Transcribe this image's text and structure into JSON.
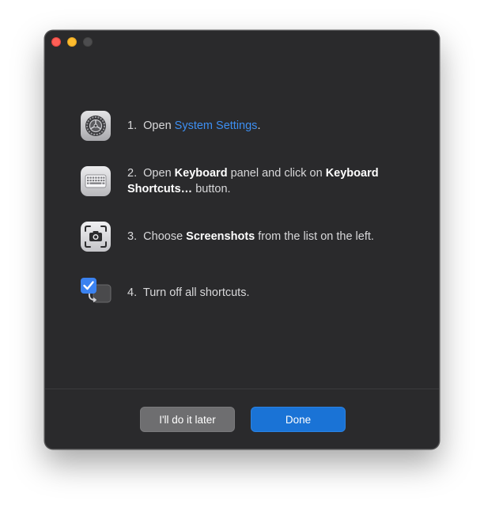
{
  "window": {
    "traffic_lights": [
      "close",
      "minimize",
      "zoom-disabled"
    ]
  },
  "steps": [
    {
      "number": "1.",
      "verb": "Open",
      "link": "System Settings",
      "suffix": ".",
      "icon": "system-settings-gear-icon"
    },
    {
      "number": "2.",
      "verb": "Open",
      "bold1": "Keyboard",
      "mid": "panel and click on",
      "bold2": "Keyboard Shortcuts…",
      "suffix": "button.",
      "icon": "keyboard-icon"
    },
    {
      "number": "3.",
      "verb": "Choose",
      "bold1": "Screenshots",
      "suffix": "from the list on the left.",
      "icon": "screenshot-camera-icon"
    },
    {
      "number": "4.",
      "text": "Turn off all shortcuts.",
      "icon": "checkbox-toggle-icon"
    }
  ],
  "buttons": {
    "later": "I'll do it later",
    "done": "Done"
  },
  "colors": {
    "background": "#2a2a2c",
    "link": "#3d8ff2",
    "primary_button": "#1a73d6",
    "secondary_button": "#6e6e70"
  }
}
